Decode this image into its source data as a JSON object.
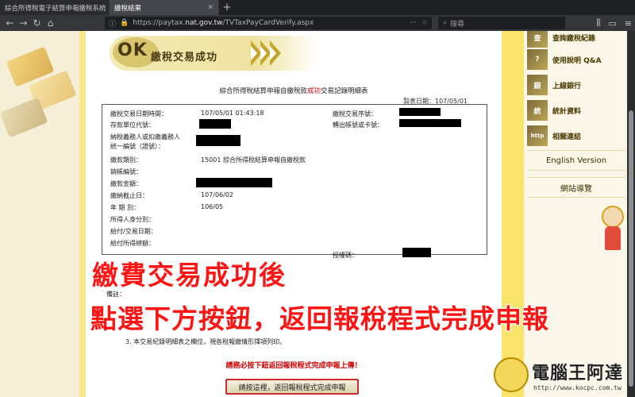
{
  "browser": {
    "tabs": [
      {
        "label": "綜合所得稅電子結算申報繳稅系統",
        "active": false
      },
      {
        "label": "繳稅結果",
        "active": true
      }
    ],
    "url_prefix": "https://paytax.",
    "url_domain": "nat.gov.tw",
    "url_path": "/TVTaxPayCardVerify.aspx",
    "search_placeholder": "搜尋"
  },
  "banner": {
    "ok": "OK",
    "title": "繳稅交易成功"
  },
  "receipt": {
    "heading_prefix": "綜合所得稅結算申報自繳稅款",
    "heading_red": "成功",
    "heading_suffix": "交易記錄明細表",
    "made_date": "製表日期：107/05/01",
    "fields": {
      "txn_datetime_label": "繳稅交易日期時間：",
      "txn_datetime_value": "107/05/01 01:43:18",
      "txn_seq_label": "繳稅交易序號：",
      "unit_code_label": "存款單位代號：",
      "account_label": "轉出帳號或卡號：",
      "taxpayer_label_1": "納稅義務人或扣繳義務人",
      "taxpayer_label_2": "統一編號（證號）：",
      "tax_type_label": "繳款類別：",
      "tax_type_value": "15001 綜合所得稅結算申報自繳稅款",
      "sales_no_label": "銷帳編號：",
      "amount_label": "繳款金額：",
      "due_label": "繳納截止日：",
      "due_value": "107/06/02",
      "year_label": "年 期 別：",
      "year_value": "106/05",
      "income_id_label": "所得人身分別：",
      "pay_date_label": "給付/交易日期：",
      "pay_total_label": "給付所得總額：",
      "auth_label": "授權碼："
    }
  },
  "notes": {
    "head": "備註：",
    "item3": "3. 本交易紀錄明細表之欄位，視各稅報繳情形擇項列印。"
  },
  "must_text": "請務必按下鈕返回報稅程式完成申報上傳！",
  "return_button": "請按這裡，返回報稅程式完成申報",
  "sidebar": {
    "items": [
      {
        "icon": "查",
        "label": "查詢繳稅紀錄"
      },
      {
        "icon": "?",
        "label": "使用說明 Q&A"
      },
      {
        "icon": "銀",
        "label": "上線銀行"
      },
      {
        "icon": "統",
        "label": "統計資料"
      },
      {
        "icon": "http",
        "label": "相關連結"
      }
    ],
    "english": "English Version",
    "sitemap": "網站導覽"
  },
  "overlay": {
    "line1": "繳費交易成功後",
    "line2": "點選下方按鈕，返回報稅程式完成申報"
  },
  "watermark": {
    "name": "電腦王阿達",
    "url": "http://www.kocpc.com.tw"
  }
}
